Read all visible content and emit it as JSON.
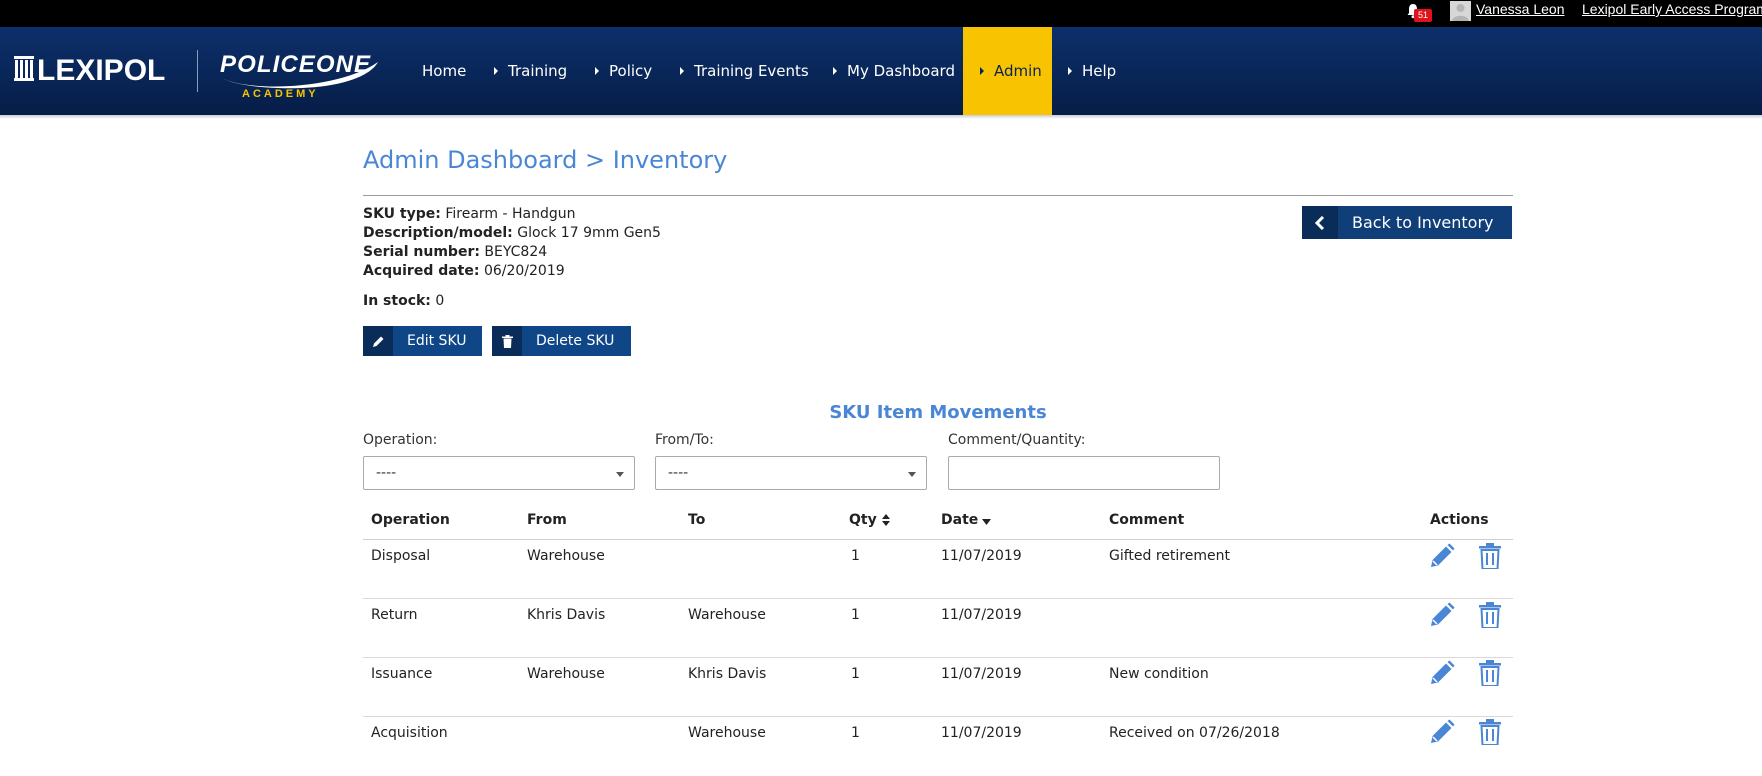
{
  "topbar": {
    "notification_count": "51",
    "user_name": "Vanessa Leon",
    "program_link": "Lexipol Early Access Program"
  },
  "brand": {
    "lexipol": "LEXIPOL",
    "policeone": "POLICEONE",
    "academy": "ACADEMY",
    "accent_color": "#f8c301",
    "nav_color": "#082556"
  },
  "nav": {
    "items": [
      {
        "label": "Home"
      },
      {
        "label": "Training"
      },
      {
        "label": "Policy"
      },
      {
        "label": "Training Events"
      },
      {
        "label": "My Dashboard"
      },
      {
        "label": "Admin"
      },
      {
        "label": "Help"
      }
    ]
  },
  "page": {
    "title": "Admin Dashboard > Inventory",
    "back_button": "Back to Inventory"
  },
  "sku": {
    "type_label": "SKU type:",
    "type_value": "Firearm - Handgun",
    "desc_label": "Description/model:",
    "desc_value": "Glock 17 9mm Gen5",
    "serial_label": "Serial number:",
    "serial_value": "BEYC824",
    "acquired_label": "Acquired date:",
    "acquired_value": "06/20/2019",
    "stock_label": "In stock:",
    "stock_value": "0",
    "edit_button": "Edit SKU",
    "delete_button": "Delete SKU"
  },
  "movements": {
    "section_title": "SKU Item Movements",
    "filters": {
      "operation_label": "Operation:",
      "operation_value": "----",
      "fromto_label": "From/To:",
      "fromto_value": "----",
      "comment_label": "Comment/Quantity:",
      "comment_value": ""
    },
    "columns": {
      "operation": "Operation",
      "from": "From",
      "to": "To",
      "qty": "Qty",
      "date": "Date",
      "comment": "Comment",
      "actions": "Actions"
    },
    "rows": [
      {
        "operation": "Disposal",
        "from": "Warehouse",
        "to": "",
        "qty": "1",
        "date": "11/07/2019",
        "comment": "Gifted retirement"
      },
      {
        "operation": "Return",
        "from": "Khris Davis",
        "to": "Warehouse",
        "qty": "1",
        "date": "11/07/2019",
        "comment": ""
      },
      {
        "operation": "Issuance",
        "from": "Warehouse",
        "to": "Khris Davis",
        "qty": "1",
        "date": "11/07/2019",
        "comment": "New condition"
      },
      {
        "operation": "Acquisition",
        "from": "",
        "to": "Warehouse",
        "qty": "1",
        "date": "11/07/2019",
        "comment": "Received on 07/26/2018"
      }
    ]
  }
}
